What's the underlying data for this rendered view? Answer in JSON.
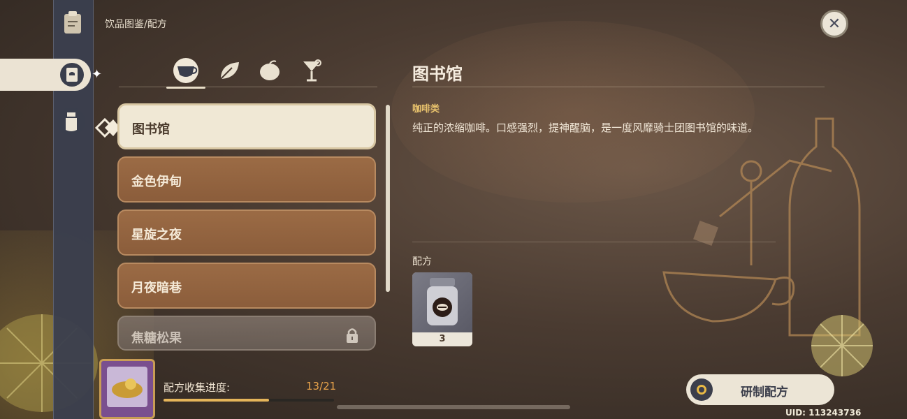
{
  "breadcrumb": "饮品图鉴/配方",
  "categories": [
    {
      "name": "coffee",
      "active": true
    },
    {
      "name": "tea",
      "active": false
    },
    {
      "name": "fruit",
      "active": false
    },
    {
      "name": "cocktail",
      "active": false
    }
  ],
  "list": [
    {
      "label": "图书馆",
      "state": "selected"
    },
    {
      "label": "金色伊甸",
      "state": "normal"
    },
    {
      "label": "星旋之夜",
      "state": "normal"
    },
    {
      "label": "月夜暗巷",
      "state": "normal"
    },
    {
      "label": "焦糖松果",
      "state": "locked"
    }
  ],
  "detail": {
    "title": "图书馆",
    "category": "咖啡类",
    "description": "纯正的浓缩咖啡。口感强烈，提神醒脑，是一度风靡骑士团图书馆的味道。",
    "recipe_label": "配方",
    "ingredients": [
      {
        "icon": "coffee-bean-jar-icon",
        "count": "3"
      }
    ]
  },
  "progress": {
    "label": "配方收集进度:",
    "count_text": "13/21",
    "fraction": 0.619
  },
  "craft_button": "研制配方",
  "uid": "UID: 113243736"
}
